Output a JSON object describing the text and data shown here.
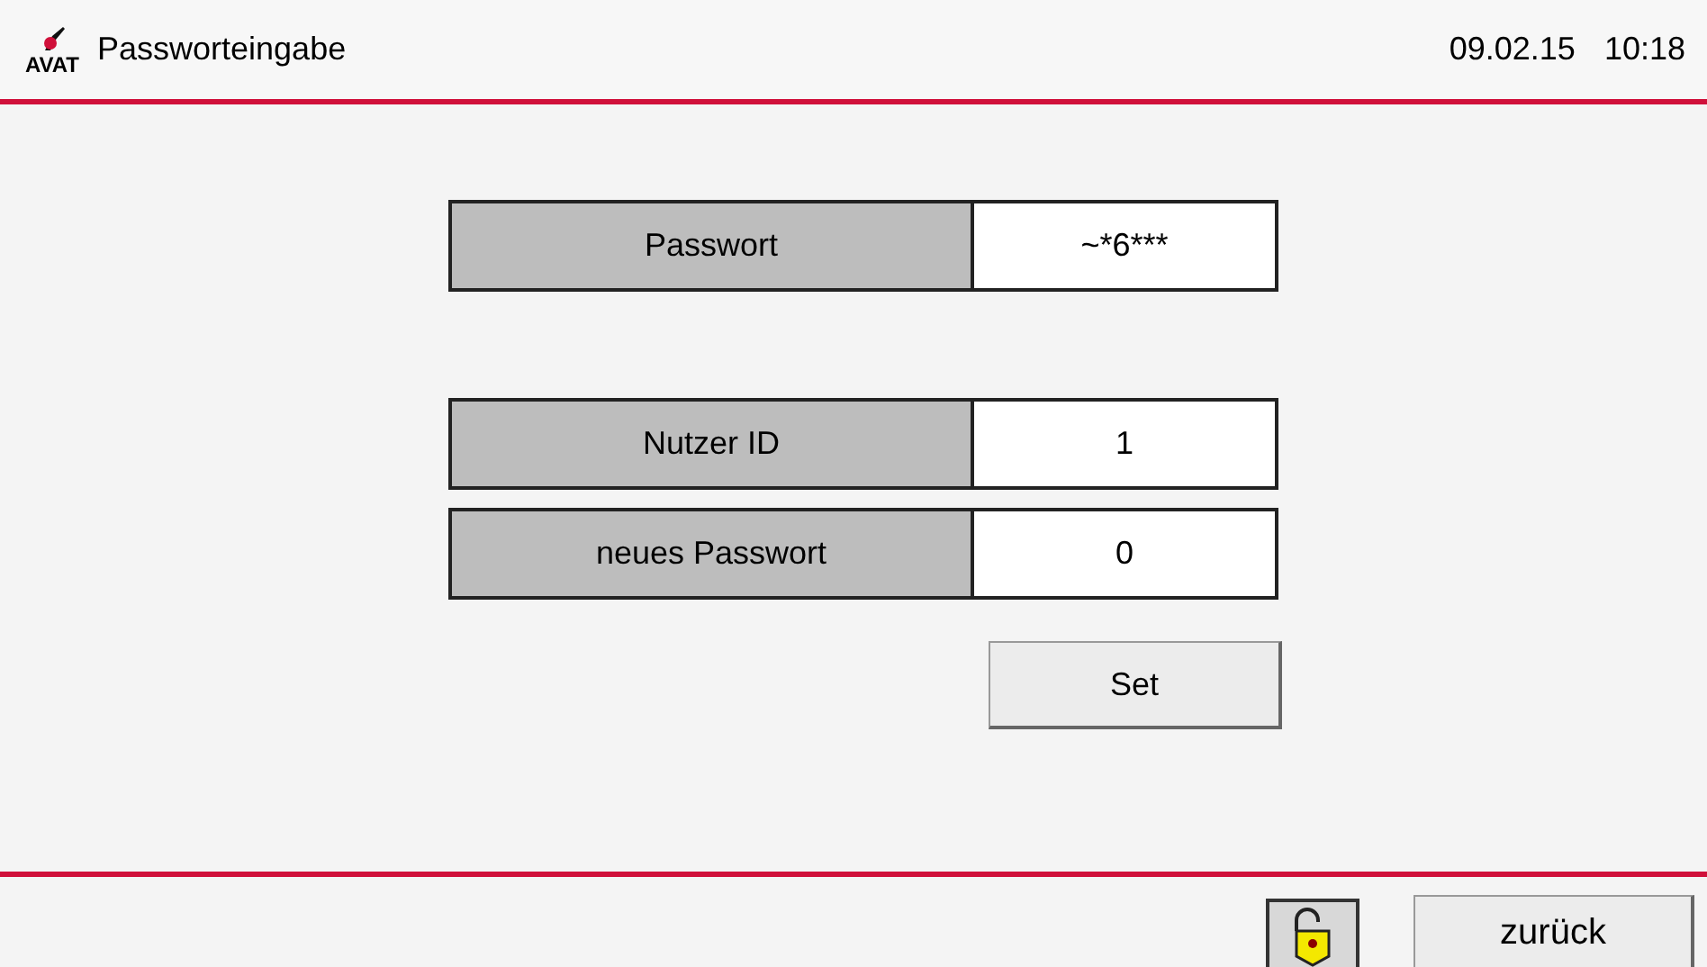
{
  "header": {
    "logo": "AVAT",
    "title": "Passworteingabe",
    "date": "09.02.15",
    "time": "10:18"
  },
  "password": {
    "label": "Passwort",
    "value": "~*6***"
  },
  "fields": [
    {
      "label": "Nutzer ID",
      "value": "1"
    },
    {
      "label": "neues Passwort",
      "value": "0"
    }
  ],
  "set_button": "Set",
  "footer": {
    "lock_unlocked": true,
    "back_button": "zurück"
  }
}
